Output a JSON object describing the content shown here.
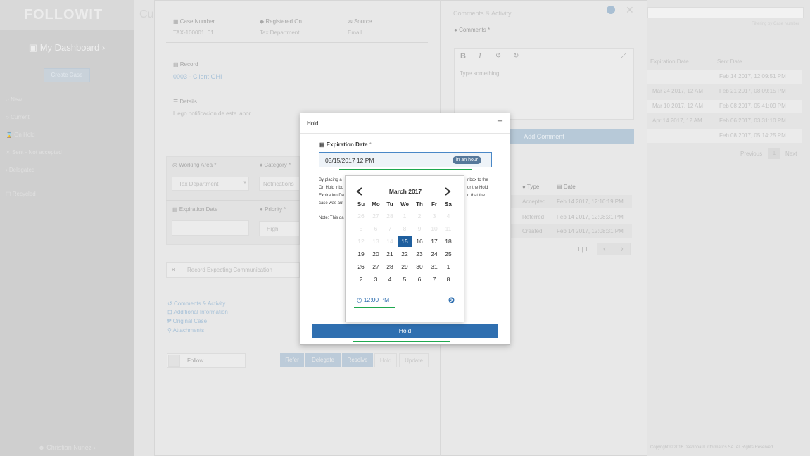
{
  "app": {
    "logo": "FOLLOWIT",
    "dashboard": "My Dashboard",
    "create_case": "Create Case",
    "user": "Christian Nunez"
  },
  "sidebar": {
    "items": [
      {
        "label": "New",
        "icon": "circle-icon"
      },
      {
        "label": "Current",
        "icon": "circle-icon"
      },
      {
        "label": "On Hold",
        "icon": "hourglass-icon"
      },
      {
        "label": "Sent - Not accepted",
        "icon": "cross-icon"
      },
      {
        "label": "Delegated",
        "icon": "arrow-icon"
      },
      {
        "label": "Recycled",
        "icon": "trash-icon"
      }
    ]
  },
  "background": {
    "title": "Cu",
    "filter_hint": "Filtering by Case Number",
    "columns": [
      "Expiration Date",
      "Sent Date"
    ],
    "rows": [
      {
        "expiration": "",
        "sent": "Feb 14 2017, 12:09:51 PM"
      },
      {
        "expiration": "Mar 24 2017, 12 AM",
        "sent": "Feb 21 2017, 08:09:15 PM"
      },
      {
        "expiration": "Mar 10 2017, 12 AM",
        "sent": "Feb 08 2017, 05:41:09 PM"
      },
      {
        "expiration": "Apr 14 2017, 12 AM",
        "sent": "Feb 06 2017, 03:31:10 PM"
      },
      {
        "expiration": "",
        "sent": "Feb 08 2017, 05:14:25 PM"
      }
    ],
    "pagination": {
      "previous": "Previous",
      "page": "1",
      "next": "Next"
    },
    "footer": "Copyright © 2016 Dashboard Informatics SA. All Rights Reserved."
  },
  "case": {
    "case_number_label": "Case Number",
    "case_number": "TAX-100001 .01",
    "registered_label": "Registered On",
    "registered": "Tax Department",
    "source_label": "Source",
    "source": "Email",
    "record_label": "Record",
    "record": "0003 - Client GHI",
    "details_label": "Details",
    "details": "Llego notificacion de este labor.",
    "working_area_label": "Working Area",
    "working_area": "Tax Department",
    "category_label": "Category",
    "category": "Notifications",
    "expiration_label": "Expiration Date",
    "priority_label": "Priority",
    "priority": "High",
    "expecting": "Record Expecting Communication",
    "links": [
      "Comments & Activity",
      "Additional Information",
      "Original Case",
      "Attachments"
    ],
    "follow": "Follow",
    "actions": [
      "Refer",
      "Delegate",
      "Resolve",
      "Hold",
      "Update"
    ]
  },
  "comments": {
    "title": "Comments & Activity",
    "comments_label": "Comments",
    "placeholder": "Type something",
    "add": "Add Comment",
    "activity_columns": [
      "Type",
      "Date"
    ],
    "activity": [
      {
        "type": "Accepted",
        "date": "Feb 14 2017, 12:10:19 PM"
      },
      {
        "type": "Referred",
        "date": "Feb 14 2017, 12:08:31 PM"
      },
      {
        "type": "Created",
        "date": "Feb 14 2017, 12:08:31 PM"
      }
    ],
    "pages": "1 | 1"
  },
  "hold": {
    "title": "Hold",
    "expiration_label": "Expiration Date",
    "required_mark": "*",
    "value": "03/15/2017 12 PM",
    "relative": "in an hour",
    "text_lines_left": [
      "By placing a",
      "On Hold inbo",
      "Expiration Da",
      "case was aut"
    ],
    "text_lines_right": [
      "nbox to the",
      "or the Hold",
      "d that the"
    ],
    "note": "Note: This da",
    "button": "Hold"
  },
  "calendar": {
    "month": "March 2017",
    "dow": [
      "Su",
      "Mo",
      "Tu",
      "We",
      "Th",
      "Fr",
      "Sa"
    ],
    "weeks": [
      [
        "26",
        "27",
        "28",
        "1",
        "2",
        "3",
        "4"
      ],
      [
        "5",
        "6",
        "7",
        "8",
        "9",
        "10",
        "11"
      ],
      [
        "12",
        "13",
        "14",
        "15",
        "16",
        "17",
        "18"
      ],
      [
        "19",
        "20",
        "21",
        "22",
        "23",
        "24",
        "25"
      ],
      [
        "26",
        "27",
        "28",
        "29",
        "30",
        "31",
        "1"
      ],
      [
        "2",
        "3",
        "4",
        "5",
        "6",
        "7",
        "8"
      ]
    ],
    "disabled_through": "14",
    "selected": "15",
    "time": "12:00 PM"
  },
  "colors": {
    "accent": "#2f6fb0",
    "selected": "#1f5f9e",
    "annotation": "#1fa84f"
  }
}
